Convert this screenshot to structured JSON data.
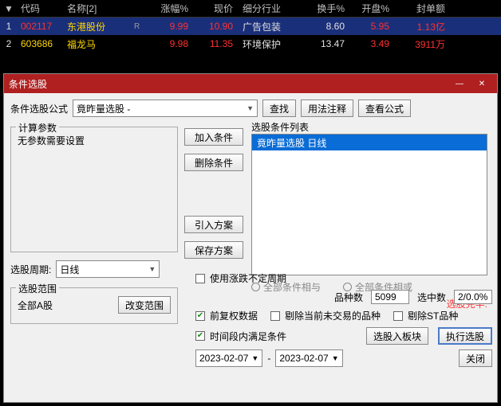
{
  "grid": {
    "headers": {
      "code": "代码",
      "name": "名称[2]",
      "pct": "涨幅%",
      "price": "现价",
      "industry": "细分行业",
      "turnover": "换手%",
      "open": "开盘%",
      "seal": "封单额"
    },
    "rows": [
      {
        "idx": "1",
        "code": "002117",
        "name": "东港股份",
        "r": "R",
        "pct": "9.99",
        "price": "10.90",
        "industry": "广告包装",
        "turnover": "8.60",
        "open": "5.95",
        "seal": "1.13亿",
        "hl": true,
        "codeColor": "red",
        "nameColor": "yellow"
      },
      {
        "idx": "2",
        "code": "603686",
        "name": "福龙马",
        "r": "",
        "pct": "9.98",
        "price": "11.35",
        "industry": "环境保护",
        "turnover": "13.47",
        "open": "3.49",
        "seal": "3911万",
        "hl": false,
        "codeColor": "yellow",
        "nameColor": "yellow"
      }
    ]
  },
  "dialog": {
    "title": "条件选股",
    "formula_label": "条件选股公式",
    "formula_value": "竟昨量选股   -",
    "btn_find": "查找",
    "btn_usage": "用法注释",
    "btn_view": "查看公式",
    "params": {
      "legend": "计算参数",
      "text": "无参数需要设置"
    },
    "btn_add": "加入条件",
    "btn_del": "删除条件",
    "btn_import": "引入方案",
    "btn_save": "保存方案",
    "period_label": "选股周期:",
    "period_value": "日线",
    "cond_list_label": "选股条件列表",
    "cond_item": "竟昨量选股  日线",
    "radio_and": "全部条件相与",
    "radio_or": "全部条件相或",
    "status": "选股完毕.",
    "scope": {
      "legend": "选股范围",
      "text": "全部A股",
      "btn": "改变范围"
    },
    "chk_uncertain": "使用涨跌不定周期",
    "stats": {
      "variety_label": "品种数",
      "variety_val": "5099",
      "hit_label": "选中数",
      "hit_val": "2/0.0%"
    },
    "chk_fq": "前复权数据",
    "chk_rm_nontrade": "剔除当前未交易的品种",
    "chk_rm_st": "剔除ST品种",
    "chk_time": "时间段内满足条件",
    "btn_toblock": "选股入板块",
    "btn_exec": "执行选股",
    "btn_close": "关闭",
    "date_from": "2023-02-07",
    "date_to": "2023-02-07",
    "date_sep": "-"
  }
}
